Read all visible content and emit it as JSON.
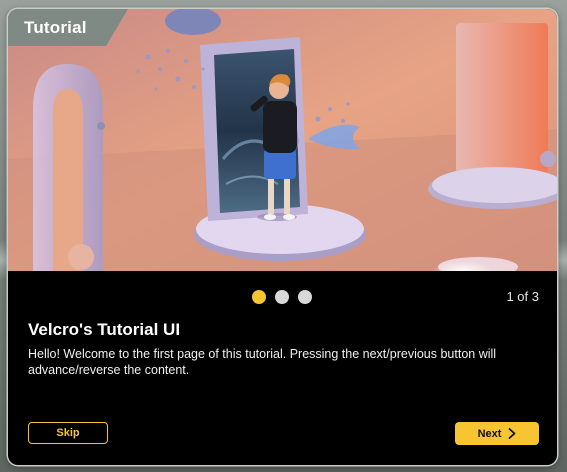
{
  "window": {
    "title": "Tutorial"
  },
  "pager": {
    "total": 3,
    "current": 1,
    "count_label": "1 of 3"
  },
  "content": {
    "title": "Velcro's Tutorial UI",
    "body": "Hello! Welcome to the first page of this tutorial. Pressing the next/previous button will advance/reverse the content."
  },
  "buttons": {
    "skip_label": "Skip",
    "next_label": "Next",
    "next_icon": "chevron-right-icon"
  },
  "colors": {
    "accent": "#f7c531",
    "panel_bg": "#000000",
    "title_tab": "#7f8a84"
  }
}
